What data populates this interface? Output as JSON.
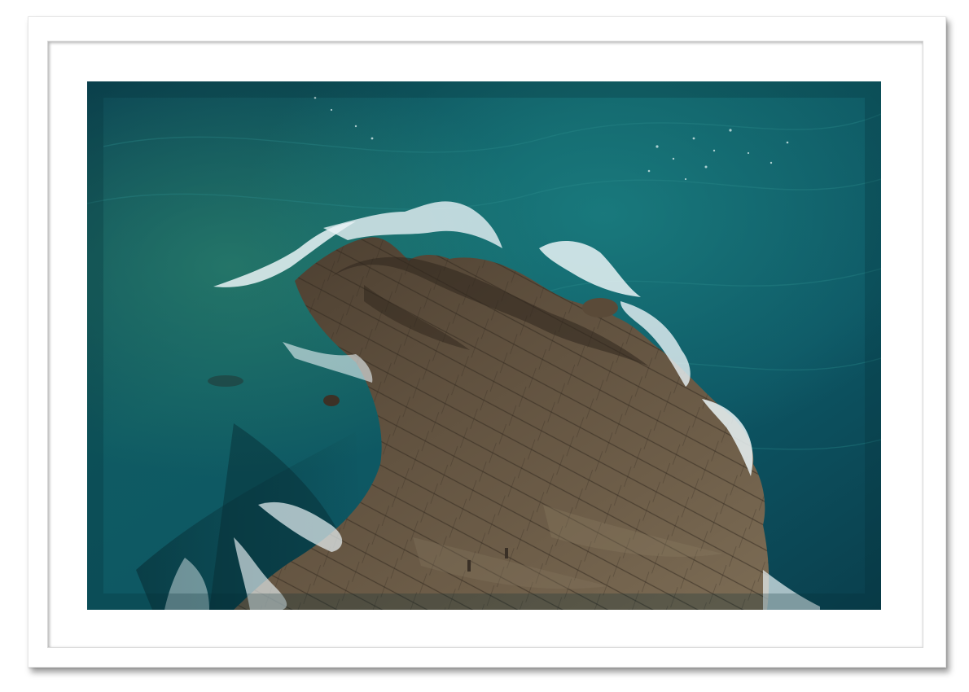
{
  "artwork": {
    "subject": "",
    "colors": {
      "sea_deep": "#0b3f4c",
      "sea_mid": "#0f5f66",
      "sea_light": "#1c7d7a",
      "rock": "#6b5a45",
      "rock_dark": "#3a2f25",
      "foam": "#e9f3f6",
      "frame": "#ffffff",
      "mat": "#ffffff"
    }
  }
}
